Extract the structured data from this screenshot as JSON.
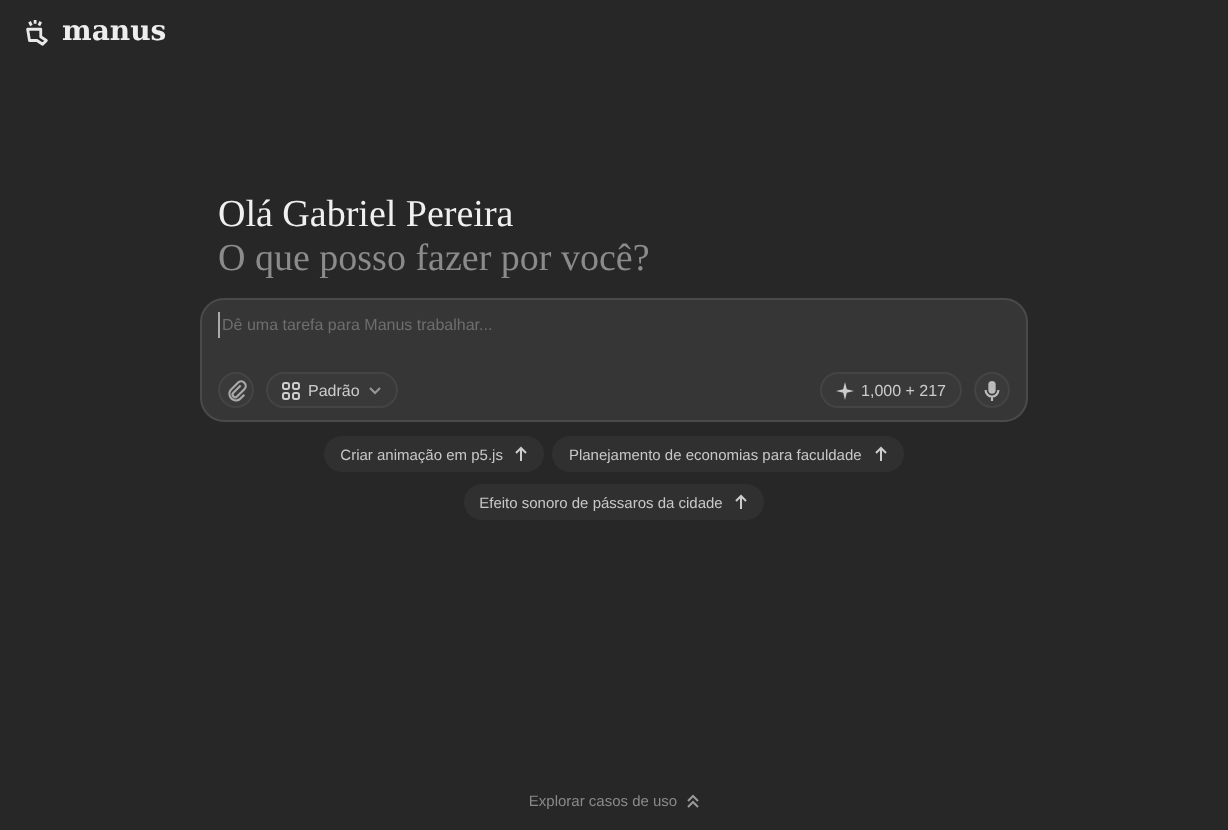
{
  "brand": {
    "name": "manus"
  },
  "greeting": {
    "title": "Olá Gabriel Pereira",
    "subtitle": "O que posso fazer por você?"
  },
  "composer": {
    "placeholder": "Dê uma tarefa para Manus trabalhar...",
    "mode": "Padrão",
    "credits": "1,000 + 217"
  },
  "suggestions": [
    {
      "label": "Criar animação em p5.js"
    },
    {
      "label": "Planejamento de economias para faculdade"
    },
    {
      "label": "Efeito sonoro de pássaros da cidade"
    }
  ],
  "footer": {
    "link": "Explorar casos de uso"
  }
}
